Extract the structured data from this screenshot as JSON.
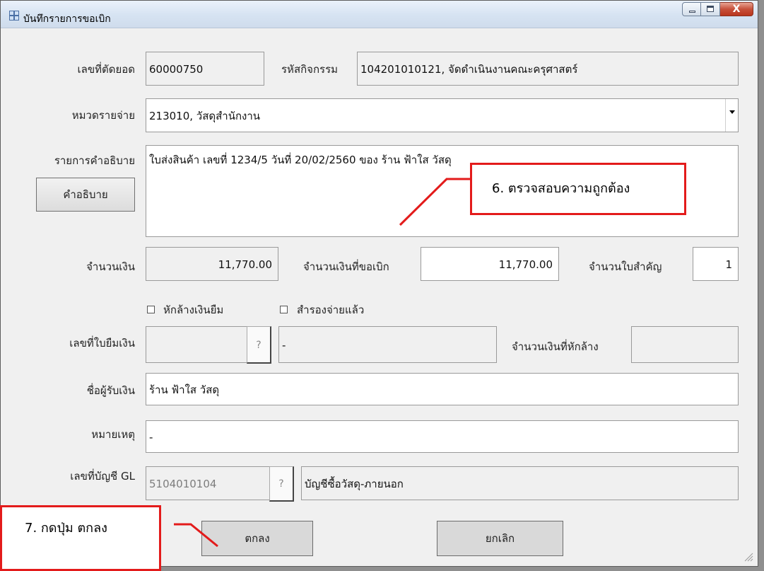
{
  "window": {
    "title": "บันทึกรายการขอเบิก",
    "close_glyph": "X"
  },
  "fields": {
    "cut_no_label": "เลขที่ตัดยอด",
    "cut_no_value": "60000750",
    "activity_code_label": "รหัสกิจกรรม",
    "activity_code_value": "104201010121, จัดดำเนินงานคณะครุศาสตร์",
    "expense_category_label": "หมวดรายจ่าย",
    "expense_category_value": "213010, วัสดุสำนักงาน",
    "description_label": "รายการคำอธิบาย",
    "description_button": "คำอธิบาย",
    "description_value": "ใบส่งสินค้า เลขที่ 1234/5 วันที่ 20/02/2560 ของ ร้าน ฟ้าใส วัสดุ",
    "amount_label": "จำนวนเงิน",
    "amount_value": "11,770.00",
    "request_amount_label": "จำนวนเงินที่ขอเบิก",
    "request_amount_value": "11,770.00",
    "receipt_count_label": "จำนวนใบสำคัญ",
    "receipt_count_value": "1",
    "deduct_loan_label": "หักล้างเงินยืม",
    "advance_paid_label": "สำรองจ่ายแล้ว",
    "loan_no_label": "เลขที่ใบยืมเงิน",
    "loan_no_value": "",
    "loan_help_button": "?",
    "loan_desc_value": "-",
    "deduct_amount_label": "จำนวนเงินที่หักล้าง",
    "deduct_amount_value": "",
    "payee_label": "ชื่อผู้รับเงิน",
    "payee_value": "ร้าน ฟ้าใส วัสดุ",
    "remark_label": "หมายเหตุ",
    "remark_value": "-",
    "gl_label": "เลขที่บัญชี GL",
    "gl_value": "5104010104",
    "gl_help_button": "?",
    "gl_name_value": "บัญชีซื้อวัสดุ-ภายนอก"
  },
  "buttons": {
    "ok": "ตกลง",
    "cancel": "ยกเลิก"
  },
  "annotations": {
    "step6": "6.  ตรวจสอบความถูกต้อง",
    "step7": "7. กดปุ่ม ตกลง"
  },
  "colors": {
    "callout_border": "#e31b1b",
    "window_bg": "#f0f0f0"
  }
}
